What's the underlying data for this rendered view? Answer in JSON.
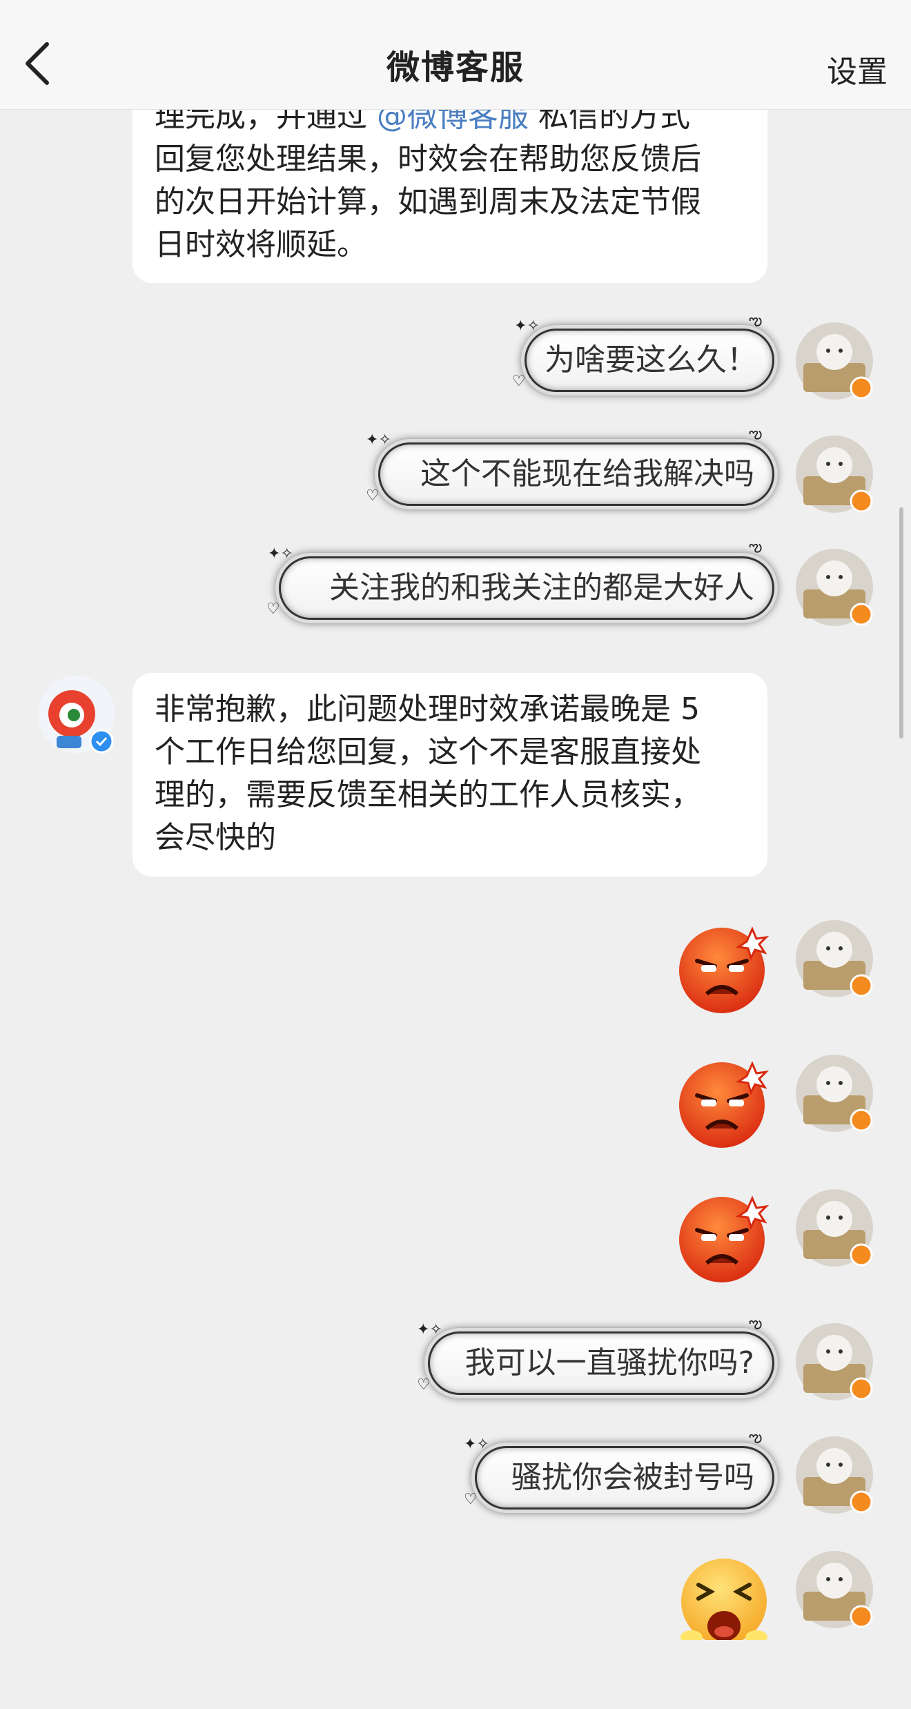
{
  "header": {
    "title": "微博客服",
    "settings_label": "设置"
  },
  "messages": {
    "bot_1": {
      "line_1_a": "理完成，并通过",
      "line_1_link": "@微博客服",
      "line_1_b": "私信的方式",
      "line_2": "回复您处理结果，时效会在帮助您反馈后",
      "line_3": "的次日开始计算，如遇到周末及法定节假",
      "line_4": "日时效将顺延。"
    },
    "user_1": "为啥要这么久！",
    "user_2": "这个不能现在给我解决吗",
    "user_3": "关注我的和我关注的都是大好人",
    "bot_2": {
      "line_1": "非常抱歉，此问题处理时效承诺最晚是 5",
      "line_2": "个工作日给您回复，这个不是客服直接处",
      "line_3": "理的，需要反馈至相关的工作人员核实，",
      "line_4": "会尽快的"
    },
    "user_emoji_1": "angry-face",
    "user_emoji_2": "angry-face",
    "user_emoji_3": "angry-face",
    "user_4": "我可以一直骚扰你吗?",
    "user_5": "骚扰你会被封号吗",
    "user_emoji_4": "crying-face"
  },
  "colors": {
    "link": "#4a7ec1",
    "verified_badge_user": "#f58a1f",
    "verified_badge_bot": "#2d8ff0",
    "background": "#efeff0"
  }
}
